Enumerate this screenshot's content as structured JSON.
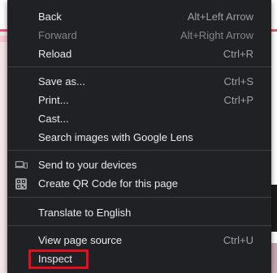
{
  "menu": {
    "items": [
      {
        "label": "Back",
        "shortcut": "Alt+Left Arrow",
        "disabled": false
      },
      {
        "label": "Forward",
        "shortcut": "Alt+Right Arrow",
        "disabled": true
      },
      {
        "label": "Reload",
        "shortcut": "Ctrl+R",
        "disabled": false
      },
      {
        "label": "Save as...",
        "shortcut": "Ctrl+S",
        "disabled": false
      },
      {
        "label": "Print...",
        "shortcut": "Ctrl+P",
        "disabled": false
      },
      {
        "label": "Cast...",
        "shortcut": "",
        "disabled": false
      },
      {
        "label": "Search images with Google Lens",
        "shortcut": "",
        "disabled": false
      },
      {
        "label": "Send to your devices",
        "shortcut": "",
        "icon": "devices-icon",
        "disabled": false
      },
      {
        "label": "Create QR Code for this page",
        "shortcut": "",
        "icon": "qr-code-icon",
        "disabled": false
      },
      {
        "label": "Translate to English",
        "shortcut": "",
        "disabled": false
      },
      {
        "label": "View page source",
        "shortcut": "Ctrl+U",
        "disabled": false
      },
      {
        "label": "Inspect",
        "shortcut": "",
        "disabled": false
      }
    ],
    "highlighted_item": "Inspect",
    "highlight_color": "#e0101e"
  },
  "colors": {
    "menu_bg": "#202124",
    "text": "#e8eaed",
    "shortcut_text": "#9aa0a6",
    "disabled_text": "#80868b",
    "separator": "#3c4043"
  }
}
